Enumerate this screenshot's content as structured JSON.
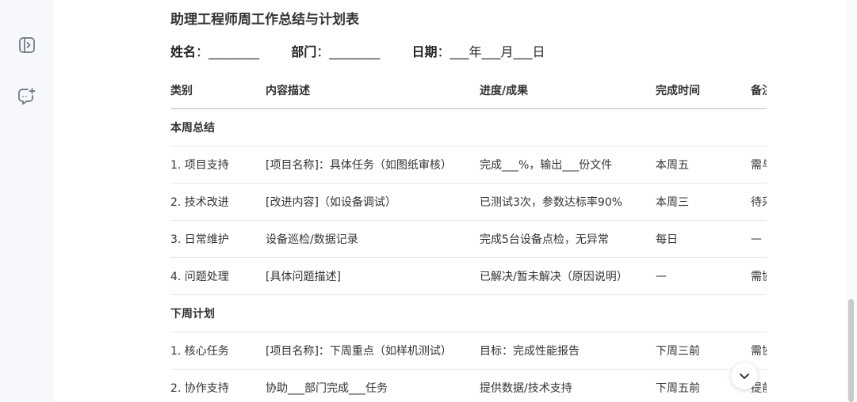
{
  "sidebar": {
    "icons": [
      "collapse-panel-icon",
      "new-chat-icon"
    ]
  },
  "document": {
    "title": "助理工程师周工作总结与计划表",
    "meta": {
      "name_label": "姓名",
      "name_value": "：________",
      "dept_label": "部门",
      "dept_value": "：________",
      "date_label": "日期",
      "date_value": "：___年___月___日"
    },
    "table": {
      "headers": [
        "类别",
        "内容描述",
        "进度/成果",
        "完成时间",
        "备注"
      ],
      "sections": [
        {
          "title": "本周总结",
          "rows": [
            [
              "1. 项目支持",
              "[项目名称]：具体任务（如图纸审核）",
              "完成___%，输出___份文件",
              "本周五",
              "需与"
            ],
            [
              "2. 技术改进",
              "[改进内容]（如设备调试）",
              "已测试3次，参数达标率90%",
              "本周三",
              "待采"
            ],
            [
              "3. 日常维护",
              "设备巡检/数据记录",
              "完成5台设备点检，无异常",
              "每日",
              "—"
            ],
            [
              "4. 问题处理",
              "[具体问题描述]",
              "已解决/暂未解决（原因说明）",
              "—",
              "需协"
            ]
          ]
        },
        {
          "title": "下周计划",
          "rows": [
            [
              "1. 核心任务",
              "[项目名称]：下周重点（如样机测试）",
              "目标：完成性能报告",
              "下周三前",
              "需协"
            ],
            [
              "2. 协作支持",
              "协助___部门完成___任务",
              "提供数据/技术支持",
              "下周五前",
              "提前"
            ]
          ]
        }
      ]
    }
  },
  "scroll_down_icon": "chevron-down-icon"
}
